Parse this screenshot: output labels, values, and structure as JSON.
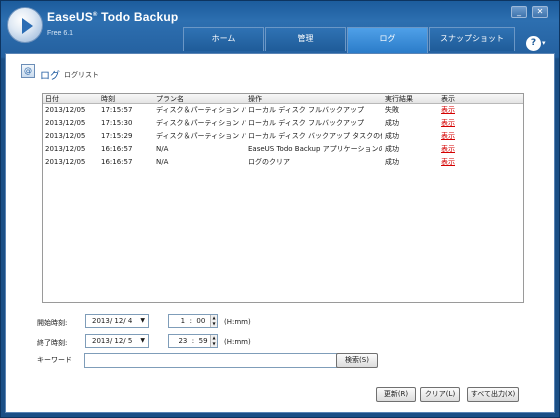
{
  "app": {
    "title": "EaseUS",
    "title_mark": "®",
    "title_product": " Todo Backup",
    "edition": "Free 6.1"
  },
  "window_controls": {
    "minimize": "_",
    "close": "✕"
  },
  "tabs": [
    {
      "label": "ホーム",
      "active": false
    },
    {
      "label": "管理",
      "active": false
    },
    {
      "label": "ログ",
      "active": true
    },
    {
      "label": "スナップショット",
      "active": false
    }
  ],
  "help": {
    "label": "?",
    "arrow": "▾"
  },
  "header": {
    "icon": "@",
    "title": "ログ",
    "subtitle": "ログリスト"
  },
  "table": {
    "columns": [
      "日付",
      "時刻",
      "プラン名",
      "操作",
      "実行結果",
      "表示"
    ],
    "rows": [
      [
        "2013/12/05",
        "17:15:57",
        "ディスク＆パーティション バー",
        "ローカル ディスク フルバックアップ",
        "失敗",
        "表示"
      ],
      [
        "2013/12/05",
        "17:15:30",
        "ディスク＆パーティション バー",
        "ローカル ディスク フルバックアップ",
        "成功",
        "表示"
      ],
      [
        "2013/12/05",
        "17:15:29",
        "ディスク＆パーティション バー",
        "ローカル ディスク バックアップ タスクの作成",
        "成功",
        "表示"
      ],
      [
        "2013/12/05",
        "16:16:57",
        "N/A",
        "EaseUS Todo Backup アプリケーションの",
        "成功",
        "表示"
      ],
      [
        "2013/12/05",
        "16:16:57",
        "N/A",
        "ログのクリア",
        "成功",
        "表示"
      ]
    ]
  },
  "filters": {
    "start_label": "開始時刻:",
    "start_date": "2013/ 12/ 4",
    "start_hour": "1",
    "start_min": "00",
    "end_label": "終了時刻:",
    "end_date": "2013/ 12/ 5",
    "end_hour": "23",
    "end_min": "59",
    "unit": "(H:mm)",
    "keyword_label": "キーワード",
    "keyword_value": "",
    "search_button": "検索(S)"
  },
  "buttons": {
    "refresh": "更新(R)",
    "clear": "クリア(L)",
    "export": "すべて出力(X)"
  },
  "colors": {
    "accent": "#2b7cc9",
    "frame": "#1c5c9c",
    "link": "#d40000"
  }
}
